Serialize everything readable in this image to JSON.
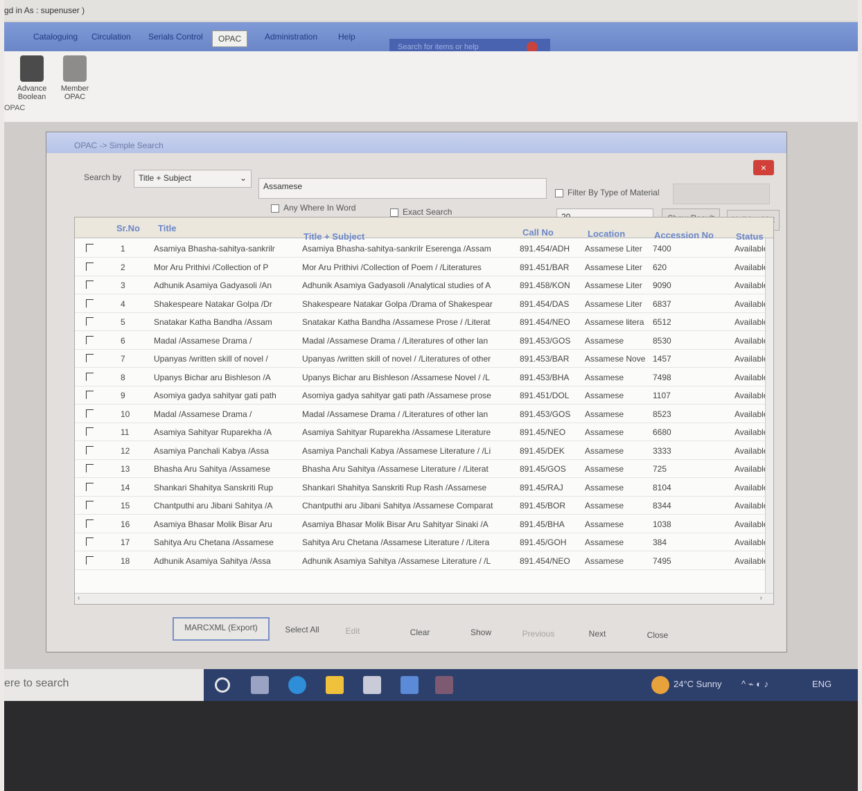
{
  "titlebar": {
    "text": "gd in As : supenuser )"
  },
  "menubar": {
    "items": [
      "Cataloguing",
      "Circulation",
      "Serials Control",
      "OPAC",
      "Administration",
      "Help"
    ],
    "search_placeholder": "Search for items or help",
    "active_index": 3
  },
  "ribbon": {
    "buttons": [
      {
        "label_line1": "Advance",
        "label_line2": "Boolean"
      },
      {
        "label_line1": "Member",
        "label_line2": "OPAC"
      }
    ],
    "group_label": "OPAC"
  },
  "dialog": {
    "title": "OPAC -> Simple Search",
    "search_by_label": "Search by",
    "search_by_value": "Title + Subject",
    "search_text": "Assamese",
    "filter_label": "Filter By Type of Material",
    "any_where_label": "Any Where In Word",
    "exact_label": "Exact Search",
    "page_size": "20",
    "show_result": "Show Result",
    "holiday_list": "Holiday List",
    "grid": {
      "headers": [
        "Sr.No",
        "Title",
        "Title + Subject",
        "Call No",
        "Location",
        "Accession No",
        "Status"
      ],
      "rows": [
        [
          "1",
          "Asamiya Bhasha-sahitya-sankrilr",
          "Asamiya Bhasha-sahitya-sankrilr Eserenga  /Assam",
          "891.454/ADH",
          "Assamese Liter",
          "7400",
          "Available"
        ],
        [
          "2",
          "Mor Aru Prithivi  /Collection of P",
          "Mor Aru Prithivi  /Collection of Poem / /Literatures",
          "891.451/BAR",
          "Assamese Liter",
          "620",
          "Available"
        ],
        [
          "3",
          "Adhunik Asamiya Gadyasoli  /An",
          "Adhunik Asamiya Gadyasoli  /Analytical studies of A",
          "891.458/KON",
          "Assamese Liter",
          "9090",
          "Available"
        ],
        [
          "4",
          "Shakespeare Natakar Golpa  /Dr",
          "Shakespeare Natakar Golpa  /Drama of Shakespear",
          "891.454/DAS",
          "Assamese Liter",
          "6837",
          "Available"
        ],
        [
          "5",
          "Snatakar Katha Bandha  /Assam",
          "Snatakar Katha Bandha  /Assamese Prose / /Literat",
          "891.454/NEO",
          "Assamese litera",
          "6512",
          "Available"
        ],
        [
          "6",
          "Madal  /Assamese Drama /",
          "Madal  /Assamese Drama / /Literatures of other lan",
          "891.453/GOS",
          "Assamese",
          "8530",
          "Available"
        ],
        [
          "7",
          "Upanyas  /written skill of novel /",
          "Upanyas  /written skill of novel / /Literatures of other",
          "891.453/BAR",
          "Assamese Nove",
          "1457",
          "Available"
        ],
        [
          "8",
          "Upanys Bichar aru Bishleson  /A",
          "Upanys Bichar aru Bishleson  /Assamese Novel / /L",
          "891.453/BHA",
          "Assamese",
          "7498",
          "Available"
        ],
        [
          "9",
          "Asomiya gadya sahityar gati path",
          "Asomiya gadya sahityar gati path  /Assamese prose",
          "891.451/DOL",
          "Assamese",
          "1107",
          "Available"
        ],
        [
          "10",
          "Madal  /Assamese Drama /",
          "Madal  /Assamese Drama / /Literatures of other lan",
          "891.453/GOS",
          "Assamese",
          "8523",
          "Available"
        ],
        [
          "11",
          "Asamiya Sahityar Ruparekha  /A",
          "Asamiya Sahityar Ruparekha  /Assamese Literature",
          "891.45/NEO",
          "Assamese",
          "6680",
          "Available"
        ],
        [
          "12",
          "Asamiya Panchali Kabya  /Assa",
          "Asamiya Panchali Kabya  /Assamese Literature / /Li",
          "891.45/DEK",
          "Assamese",
          "3333",
          "Available"
        ],
        [
          "13",
          "Bhasha Aru Sahitya  /Assamese",
          "Bhasha Aru Sahitya  /Assamese Literature / /Literat",
          "891.45/GOS",
          "Assamese",
          "725",
          "Available"
        ],
        [
          "14",
          "Shankari Shahitya Sanskriti Rup",
          "Shankari Shahitya Sanskriti Rup Rash  /Assamese",
          "891.45/RAJ",
          "Assamese",
          "8104",
          "Available"
        ],
        [
          "15",
          "Chantputhi aru Jibani Sahitya  /A",
          "Chantputhi aru Jibani Sahitya  /Assamese Comparat",
          "891.45/BOR",
          "Assamese",
          "8344",
          "Available"
        ],
        [
          "16",
          "Asamiya Bhasar Molik Bisar Aru",
          "Asamiya Bhasar Molik Bisar Aru Sahityar Sinaki  /A",
          "891.45/BHA",
          "Assamese",
          "1038",
          "Available"
        ],
        [
          "17",
          "Sahitya Aru Chetana  /Assamese",
          "Sahitya Aru Chetana  /Assamese Literature / /Litera",
          "891.45/GOH",
          "Assamese",
          "384",
          "Available"
        ],
        [
          "18",
          "Adhunik Asamiya Sahitya  /Assa",
          "Adhunik Asamiya Sahitya  /Assamese Literature / /L",
          "891.454/NEO",
          "Assamese",
          "7495",
          "Available"
        ]
      ]
    },
    "bottom_buttons": [
      "MARCXML (Export)",
      "Select All",
      "Edit",
      "Clear",
      "Show",
      "Previous",
      "Next",
      "Close"
    ]
  },
  "taskbar": {
    "search_text": "ere to search",
    "weather": "24°C  Sunny",
    "lang": "ENG"
  }
}
